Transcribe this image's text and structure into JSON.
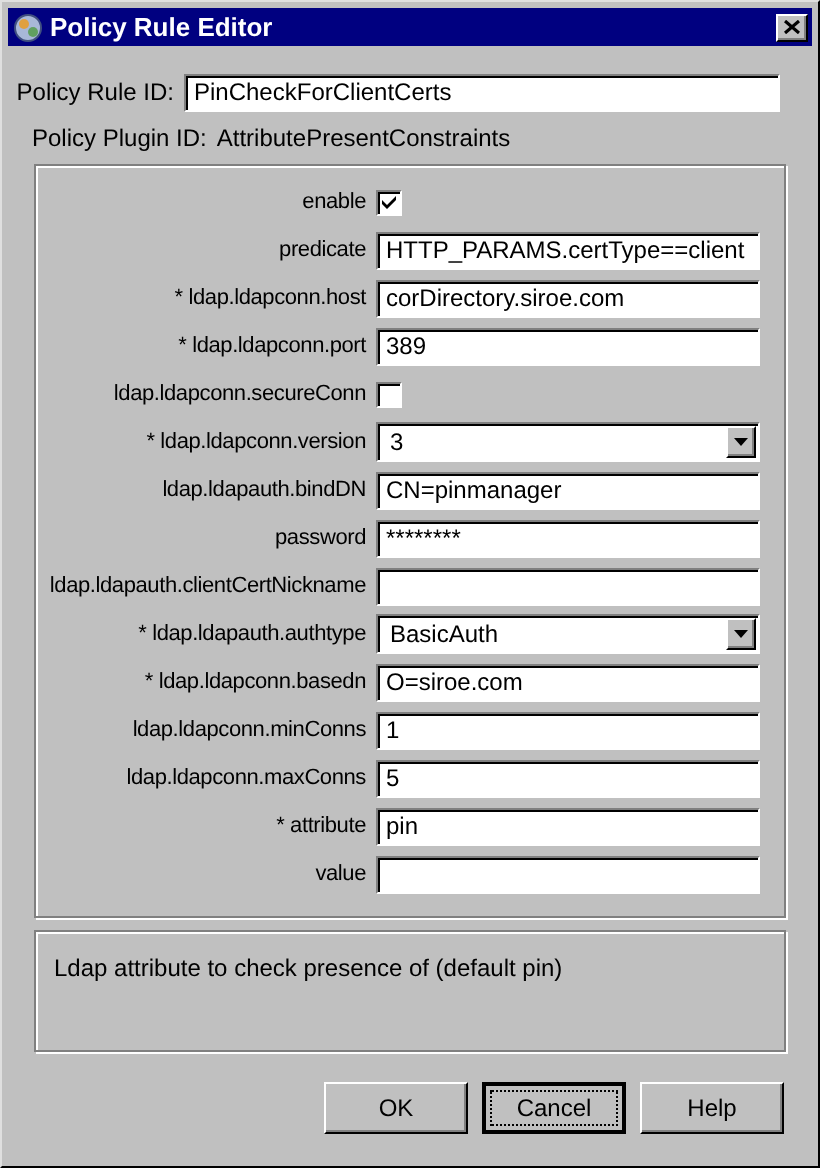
{
  "window": {
    "title": "Policy Rule Editor"
  },
  "rule_id": {
    "label": "Policy Rule ID:",
    "value": "PinCheckForClientCerts"
  },
  "plugin_id": {
    "label": "Policy Plugin ID:",
    "value": "AttributePresentConstraints"
  },
  "params": [
    {
      "kind": "checkbox",
      "label": "enable",
      "checked": true
    },
    {
      "kind": "text",
      "label": "predicate",
      "value": "HTTP_PARAMS.certType==client"
    },
    {
      "kind": "text",
      "label": "* ldap.ldapconn.host",
      "value": "corDirectory.siroe.com"
    },
    {
      "kind": "text",
      "label": "* ldap.ldapconn.port",
      "value": "389"
    },
    {
      "kind": "checkbox",
      "label": "ldap.ldapconn.secureConn",
      "checked": false
    },
    {
      "kind": "select",
      "label": "* ldap.ldapconn.version",
      "value": "3"
    },
    {
      "kind": "text",
      "label": "ldap.ldapauth.bindDN",
      "value": "CN=pinmanager"
    },
    {
      "kind": "text",
      "label": "password",
      "value": "********"
    },
    {
      "kind": "text",
      "label": "ldap.ldapauth.clientCertNickname"
    },
    {
      "kind": "select",
      "label": "* ldap.ldapauth.authtype",
      "value": "BasicAuth"
    },
    {
      "kind": "text",
      "label": "* ldap.ldapconn.basedn",
      "value": "O=siroe.com"
    },
    {
      "kind": "text",
      "label": "ldap.ldapconn.minConns",
      "value": "1"
    },
    {
      "kind": "text",
      "label": "ldap.ldapconn.maxConns",
      "value": "5"
    },
    {
      "kind": "text",
      "label": "* attribute",
      "value": "pin"
    },
    {
      "kind": "text",
      "label": "value"
    }
  ],
  "description": "Ldap attribute to check presence of (default pin)",
  "buttons": [
    {
      "label": "OK",
      "focused": false
    },
    {
      "label": "Cancel",
      "focused": true
    },
    {
      "label": "Help",
      "focused": false
    }
  ]
}
